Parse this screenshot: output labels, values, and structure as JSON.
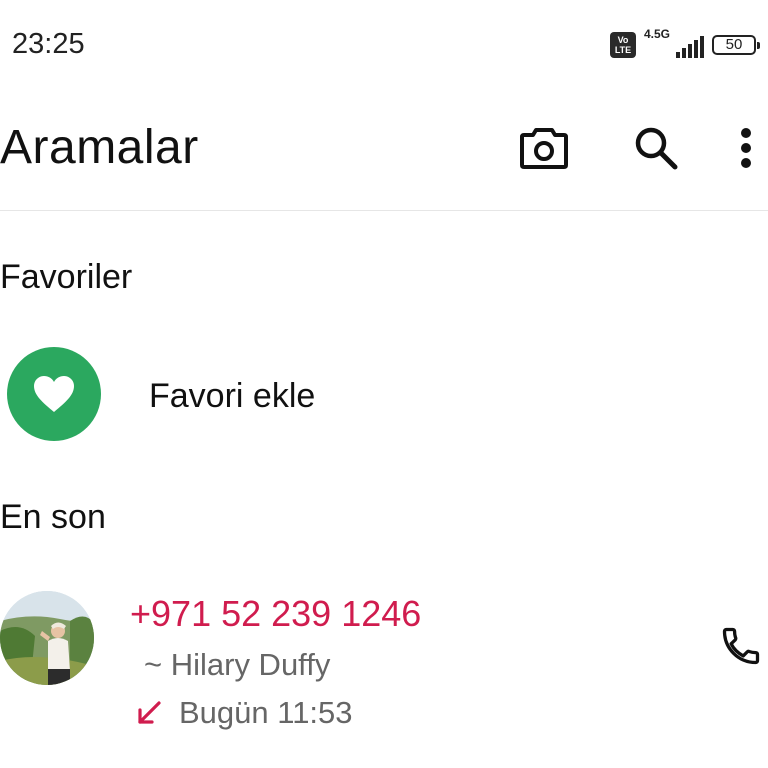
{
  "status_bar": {
    "time": "23:25",
    "volte_line1": "Vo",
    "volte_line2": "LTE",
    "network_type": "4.5G",
    "battery_level": "50"
  },
  "app_bar": {
    "title": "Aramalar",
    "icons": [
      "camera-icon",
      "search-icon",
      "more-vert-icon"
    ]
  },
  "favorites": {
    "section_title": "Favoriler",
    "add_label": "Favori ekle",
    "add_icon": "heart-icon"
  },
  "recent": {
    "section_title": "En son",
    "calls": [
      {
        "number": "+971 52 239 1246",
        "name": "~ Hilary Duffy",
        "time": "Bugün 11:53",
        "direction_icon": "missed-call-arrow-icon",
        "action_icon": "phone-icon"
      }
    ]
  },
  "colors": {
    "accent_red": "#d01c4e",
    "favorite_green": "#2ba85f",
    "divider": "#e6e6e6"
  }
}
